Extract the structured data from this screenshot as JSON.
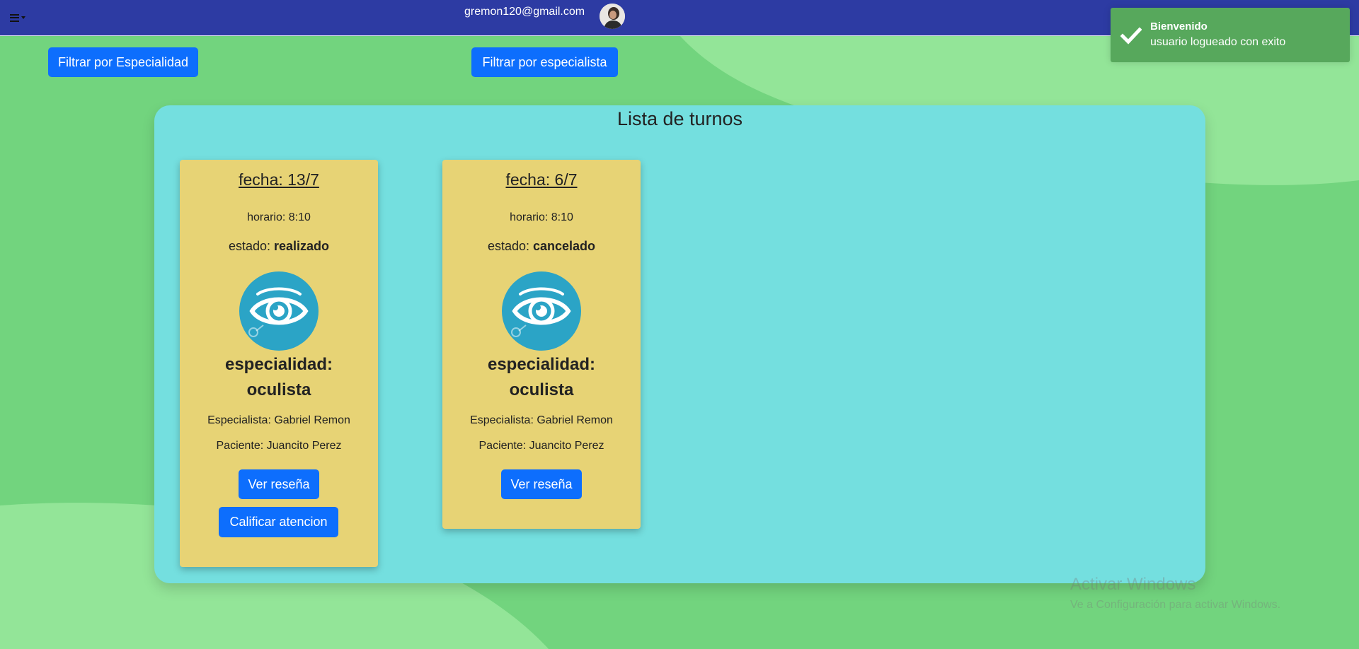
{
  "navbar": {
    "menu_icon": "hamburger-menu-icon",
    "user_email": "gremon120@gmail.com",
    "avatar_icon": "user-avatar"
  },
  "filters": {
    "by_specialty": "Filtrar por Especialidad",
    "by_specialist": "Filtrar por especialista"
  },
  "toast": {
    "icon": "check-icon",
    "title": "Bienvenido",
    "message": "usuario logueado con exito",
    "color": "#57a85c"
  },
  "panel": {
    "title": "Lista de turnos"
  },
  "appointments": [
    {
      "fecha": "fecha: 13/7",
      "horario": "horario: 8:10",
      "estado_label": "estado:",
      "estado_value": "realizado",
      "specialty_icon": "eye-icon",
      "especialidad_label": "especialidad:",
      "especialidad_value": "oculista",
      "especialista": "Especialista: Gabriel Remon",
      "paciente": "Paciente: Juancito Perez",
      "review_button": "Ver reseña",
      "rate_button": "Calificar atencion"
    },
    {
      "fecha": "fecha: 6/7",
      "horario": "horario: 8:10",
      "estado_label": "estado:",
      "estado_value": "cancelado",
      "specialty_icon": "eye-icon",
      "especialidad_label": "especialidad:",
      "especialidad_value": "oculista",
      "especialista": "Especialista: Gabriel Remon",
      "paciente": "Paciente: Juancito Perez",
      "review_button": "Ver reseña"
    }
  ],
  "watermark": {
    "line1": "Activar Windows",
    "line2": "Ve a Configuración para activar Windows."
  },
  "colors": {
    "navbar": "#2d3ba3",
    "background": "#72d47e",
    "background_wave": "#93e598",
    "panel": "#74dfdf",
    "card": "#e7d375",
    "button": "#0d6efd",
    "specialty_circle": "#2ba4c6"
  }
}
